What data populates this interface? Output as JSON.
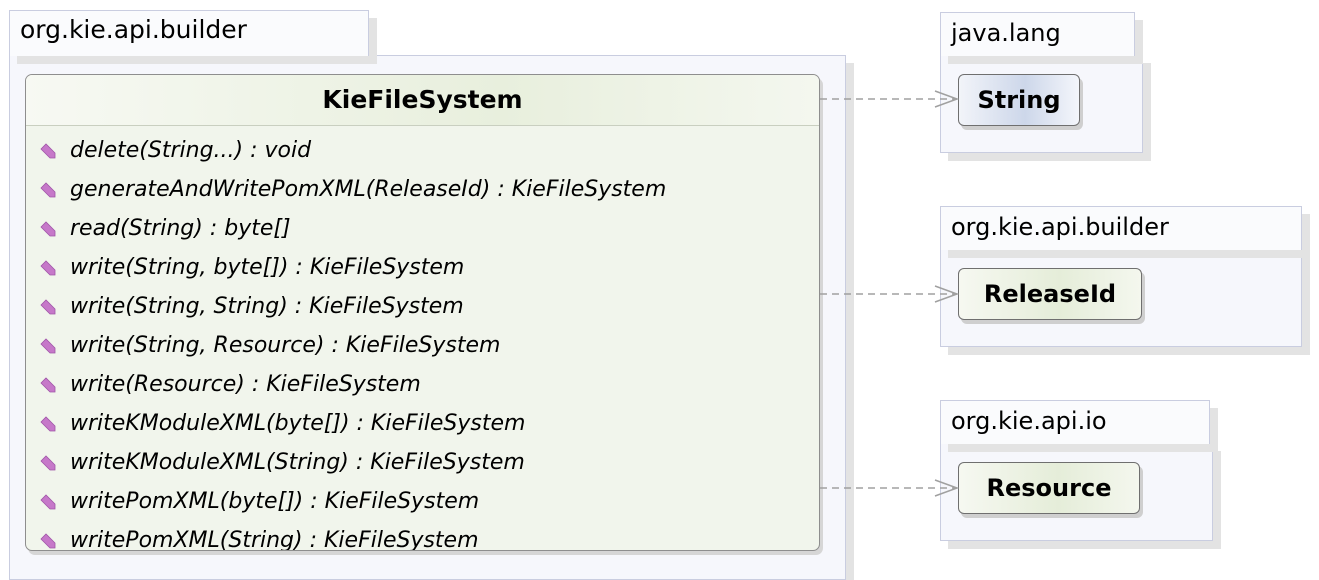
{
  "packages": {
    "main": {
      "label": "org.kie.api.builder"
    },
    "java_lang": {
      "label": "java.lang"
    },
    "builder": {
      "label": "org.kie.api.builder"
    },
    "io": {
      "label": "org.kie.api.io"
    }
  },
  "main_class": {
    "name": "KieFileSystem",
    "operations": [
      "delete(String...) : void",
      "generateAndWritePomXML(ReleaseId) : KieFileSystem",
      "read(String) : byte[]",
      "write(String, byte[]) : KieFileSystem",
      "write(String, String) : KieFileSystem",
      "write(String, Resource) : KieFileSystem",
      "write(Resource) : KieFileSystem",
      "writeKModuleXML(byte[]) : KieFileSystem",
      "writeKModuleXML(String) : KieFileSystem",
      "writePomXML(byte[]) : KieFileSystem",
      "writePomXML(String) : KieFileSystem"
    ]
  },
  "referenced_classes": {
    "string": "String",
    "release_id": "ReleaseId",
    "resource": "Resource"
  },
  "colors": {
    "operation_icon": "#c678c9",
    "dependency_line": "#a0a0a0"
  }
}
